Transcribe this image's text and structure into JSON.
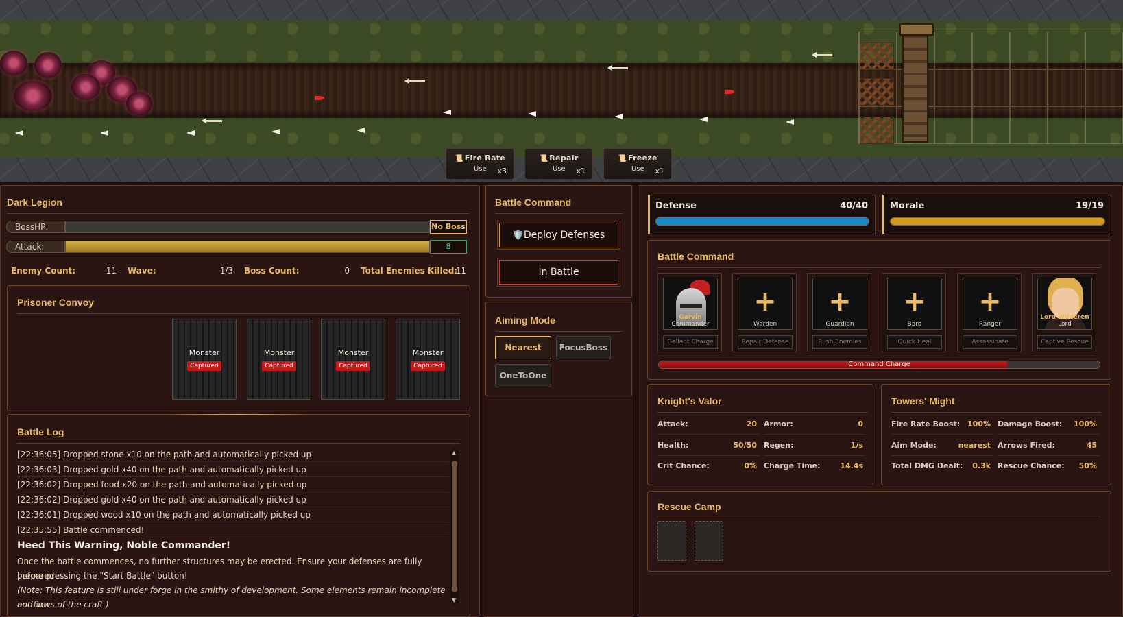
{
  "skills": [
    {
      "name": "Fire Rate",
      "use": "Use",
      "count": "x3"
    },
    {
      "name": "Repair",
      "use": "Use",
      "count": "x1"
    },
    {
      "name": "Freeze",
      "use": "Use",
      "count": "x1"
    }
  ],
  "dark_legion": {
    "title": "Dark Legion",
    "boss_label": "BossHP:",
    "boss_badge": "No Boss",
    "boss_fill": 0,
    "attack_label": "Attack:",
    "attack_value": "8",
    "attack_fill": 1.0,
    "stats": {
      "enemy_label": "Enemy Count:",
      "enemy_value": "11",
      "wave_label": "Wave:",
      "wave_value": "1/3",
      "boss_label": "Boss Count:",
      "boss_value": "0",
      "killed_label": "Total Enemies Killed:",
      "killed_value": "11"
    }
  },
  "convoy": {
    "title": "Prisoner Convoy",
    "cages": [
      {
        "name": "Monster",
        "status": "Captured"
      },
      {
        "name": "Monster",
        "status": "Captured"
      },
      {
        "name": "Monster",
        "status": "Captured"
      },
      {
        "name": "Monster",
        "status": "Captured"
      }
    ]
  },
  "log": {
    "title": "Battle Log",
    "lines": [
      "[22:36:05] Dropped stone x10 on the path and automatically picked up",
      "[22:36:03] Dropped gold x40 on the path and automatically picked up",
      "[22:36:02] Dropped food x20 on the path and automatically picked up",
      "[22:36:02] Dropped gold x40 on the path and automatically picked up",
      "[22:36:01] Dropped wood x10 on the path and automatically picked up",
      "[22:35:55] Battle commenced!"
    ],
    "warning_title": "Heed This Warning, Noble Commander!",
    "warning_line1": "Once the battle commences, no further structures may be erected. Ensure your defenses are fully prepared",
    "warning_line2": "before pressing the \"Start Battle\" button!",
    "note_line1": "(Note: This feature is still under forge in the smithy of development. Some elements remain incomplete and are",
    "note_line2": "not flaws of the craft.)"
  },
  "battle_command_mid": {
    "title": "Battle Command",
    "deploy_label": "Deploy Defenses",
    "deploy_icon": "🛡️",
    "state_label": "In Battle"
  },
  "aiming": {
    "title": "Aiming Mode",
    "options": [
      "Nearest",
      "FocusBoss",
      "OneToOne"
    ],
    "active": "Nearest"
  },
  "resources": {
    "defense_label": "Defense",
    "defense_value": "40/40",
    "defense_fill": 1.0,
    "defense_color": "#1a8ad0",
    "morale_label": "Morale",
    "morale_value": "19/19",
    "morale_fill": 1.0,
    "morale_color": "#d49a1a"
  },
  "battle_command": {
    "title": "Battle Command",
    "slots": [
      {
        "name": "Garvin",
        "role": "Commander",
        "ability": "Gallant Charge",
        "filled": true
      },
      {
        "name": "",
        "role": "Warden",
        "ability": "Repair Defense",
        "filled": false
      },
      {
        "name": "",
        "role": "Guardian",
        "ability": "Rush Enemies",
        "filled": false
      },
      {
        "name": "",
        "role": "Bard",
        "ability": "Quick Heal",
        "filled": false
      },
      {
        "name": "",
        "role": "Ranger",
        "ability": "Assassinate",
        "filled": false
      },
      {
        "name": "Lord Wilderen",
        "role": "Lord",
        "ability": "Captive Rescue",
        "filled": true
      }
    ],
    "plus_symbol": "+",
    "charge_label": "Command Charge",
    "charge_fill": 0.79
  },
  "knight": {
    "title": "Knight's Valor",
    "rows": [
      [
        {
          "label": "Attack:",
          "value": "20"
        },
        {
          "label": "Armor:",
          "value": "0"
        }
      ],
      [
        {
          "label": "Health:",
          "value": "50/50"
        },
        {
          "label": "Regen:",
          "value": "1/s"
        }
      ],
      [
        {
          "label": "Crit Chance:",
          "value": "0%"
        },
        {
          "label": "Charge Time:",
          "value": "14.4s"
        }
      ]
    ]
  },
  "towers": {
    "title": "Towers' Might",
    "rows": [
      [
        {
          "label": "Fire Rate Boost:",
          "value": "100%"
        },
        {
          "label": "Damage Boost:",
          "value": "100%"
        }
      ],
      [
        {
          "label": "Aim Mode:",
          "value": "nearest"
        },
        {
          "label": "Arrows Fired:",
          "value": "45"
        }
      ],
      [
        {
          "label": "Total DMG Dealt:",
          "value": "0.3k"
        },
        {
          "label": "Rescue Chance:",
          "value": "50%"
        }
      ]
    ]
  },
  "rescue": {
    "title": "Rescue Camp"
  }
}
